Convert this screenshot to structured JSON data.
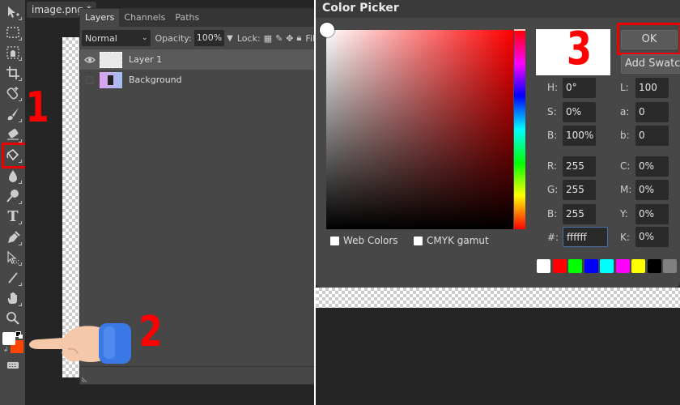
{
  "toolbar": {
    "tools": [
      {
        "name": "move-tool",
        "glyph": "↖"
      },
      {
        "name": "marquee-tool",
        "glyph": "⬚"
      },
      {
        "name": "lasso-tool",
        "glyph": "◪"
      },
      {
        "name": "crop-tool",
        "glyph": "⌗"
      },
      {
        "name": "healing-tool",
        "glyph": "✚"
      },
      {
        "name": "brush-tool",
        "glyph": "✎"
      },
      {
        "name": "eraser-tool",
        "glyph": "⌫"
      },
      {
        "name": "paint-bucket-tool",
        "glyph": "◈"
      },
      {
        "name": "blur-tool",
        "glyph": "💧"
      },
      {
        "name": "dodge-tool",
        "glyph": "⚲"
      },
      {
        "name": "type-tool",
        "glyph": "T"
      },
      {
        "name": "pen-tool",
        "glyph": "✒"
      },
      {
        "name": "path-select-tool",
        "glyph": "⇱"
      },
      {
        "name": "line-tool",
        "glyph": "╱"
      },
      {
        "name": "hand-tool",
        "glyph": "✋"
      },
      {
        "name": "zoom-tool",
        "glyph": "🔍"
      },
      {
        "name": "keyboard-icon",
        "glyph": "⌨"
      }
    ],
    "foreground_color": "#ffffff",
    "background_color": "#ff4500"
  },
  "document": {
    "tab_title": "image.png *"
  },
  "layers_panel": {
    "tabs": [
      "Layers",
      "Channels",
      "Paths"
    ],
    "active_tab": "Layers",
    "blend_mode": "Normal",
    "opacity_label": "Opacity:",
    "opacity_value": "100%",
    "lock_label": "Lock:",
    "fill_label": "Fil",
    "layers": [
      {
        "name": "Layer 1",
        "visible": true,
        "selected": true
      },
      {
        "name": "Background",
        "visible": false,
        "selected": false
      }
    ]
  },
  "annotations": {
    "step1": "1",
    "step2": "2",
    "step3": "3",
    "highlight_color": "#e00000"
  },
  "color_picker": {
    "title": "Color Picker",
    "ok_label": "OK",
    "add_swatch_label": "Add Swatch",
    "web_colors_label": "Web Colors",
    "cmyk_gamut_label": "CMYK gamut",
    "fields": {
      "H": "0°",
      "S": "0%",
      "B": "100%",
      "R": "255",
      "G": "255",
      "Bl": "255",
      "hex": "ffffff",
      "L": "100",
      "a": "0",
      "b": "0",
      "C": "0%",
      "M": "0%",
      "Y": "0%",
      "K": "0%"
    },
    "labels": {
      "H": "H:",
      "S": "S:",
      "B": "B:",
      "R": "R:",
      "G": "G:",
      "Bl": "B:",
      "hex": "#:",
      "L": "L:",
      "a": "a:",
      "b": "b:",
      "C": "C:",
      "M": "M:",
      "Y": "Y:",
      "K": "K:"
    },
    "swatches": [
      "#ffffff",
      "#ff0000",
      "#00ff00",
      "#0000ff",
      "#00ffff",
      "#ff00ff",
      "#ffff00",
      "#000000",
      "#808080"
    ]
  }
}
